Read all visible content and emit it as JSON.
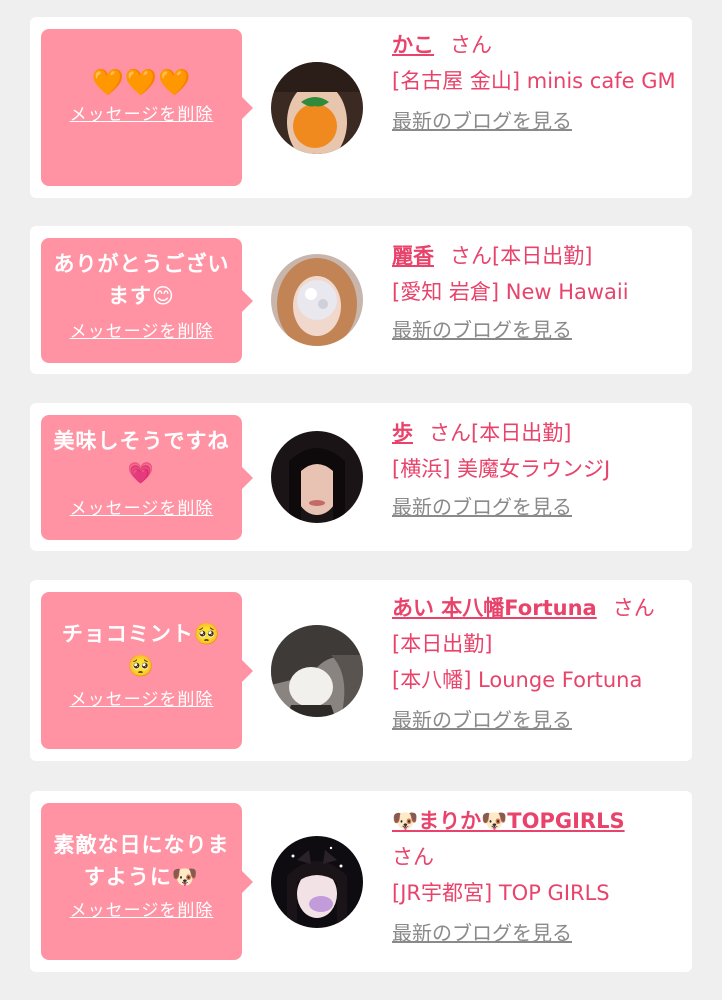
{
  "messages": [
    {
      "message": "🧡🧡🧡",
      "delete_label": "メッセージを削除",
      "name": "かこ",
      "honorific": "さん",
      "shift": "",
      "shop": "[名古屋 金山] minis cafe GM",
      "blog_label": "最新のブログを見る"
    },
    {
      "message": "ありがとうございます😊",
      "delete_label": "メッセージを削除",
      "name": "麗香",
      "honorific": "さん",
      "shift": "[本日出勤]",
      "shop": "[愛知 岩倉] New Hawaii",
      "blog_label": "最新のブログを見る"
    },
    {
      "message": "美味しそうですね💗",
      "delete_label": "メッセージを削除",
      "name": "歩",
      "honorific": "さん",
      "shift": "[本日出勤]",
      "shop": "[横浜] 美魔女ラウンジJ",
      "blog_label": "最新のブログを見る"
    },
    {
      "message": "チョコミント🥺🥺",
      "delete_label": "メッセージを削除",
      "name": "あい 本八幡Fortuna",
      "honorific": "さん",
      "shift": "[本日出勤]",
      "shop": "[本八幡] Lounge Fortuna",
      "blog_label": "最新のブログを見る"
    },
    {
      "message": "素敵な日になりますように🐶",
      "delete_label": "メッセージを削除",
      "name": "🐶まりか🐶TOPGIRLS",
      "honorific": "さん",
      "shift": "",
      "shop": "[JR宇都宮] TOP GIRLS",
      "blog_label": "最新のブログを見る"
    }
  ],
  "colors": {
    "bubble": "#ff93a3",
    "accent_text": "#e8436b",
    "link_gray": "#8a8a8a",
    "background": "#efefef"
  }
}
